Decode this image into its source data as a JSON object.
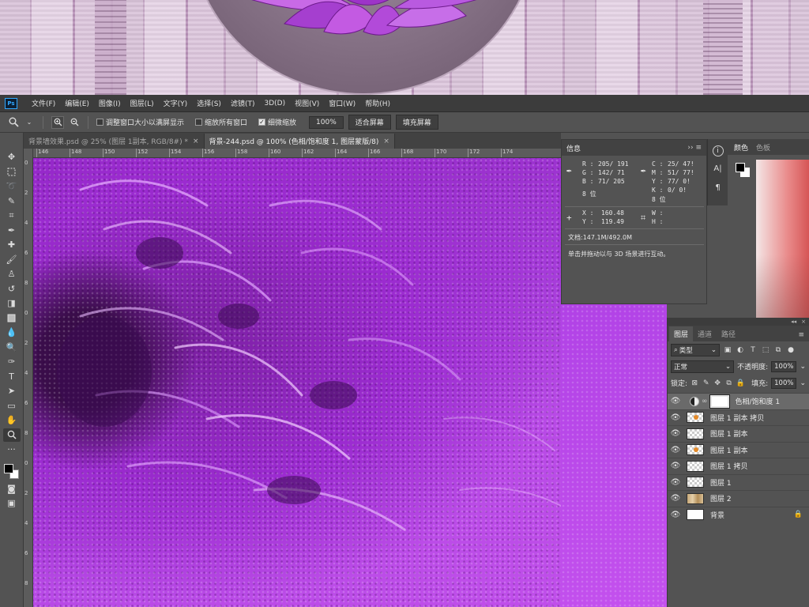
{
  "menu": [
    "文件(F)",
    "编辑(E)",
    "图像(I)",
    "图层(L)",
    "文字(Y)",
    "选择(S)",
    "滤镜(T)",
    "3D(D)",
    "视图(V)",
    "窗口(W)",
    "帮助(H)"
  ],
  "app_logo": "Ps",
  "options": {
    "resize_windows": "调整窗口大小以满屏显示",
    "zoom_all_windows": "缩放所有窗口",
    "scrubby_zoom": "细微缩放",
    "zoom_value": "100%",
    "fit_screen": "适合屏幕",
    "fill_screen": "填充屏幕"
  },
  "tabs": [
    {
      "label": "背景墙效果.psd @ 25% (图层 1副本, RGB/8#) *",
      "active": false
    },
    {
      "label": "背景-244.psd @ 100% (色相/饱和度 1, 图层蒙版/8)",
      "active": true
    }
  ],
  "ruler_h": [
    "146",
    "148",
    "150",
    "152",
    "154",
    "156",
    "158",
    "160",
    "162",
    "164",
    "166",
    "168",
    "170",
    "172",
    "174"
  ],
  "ruler_v": [
    "0",
    "2",
    "4",
    "6",
    "8",
    "0",
    "2",
    "4",
    "6",
    "8",
    "0",
    "2",
    "4",
    "6",
    "8"
  ],
  "info": {
    "title": "信息",
    "r": "R :",
    "r_val": "205/ 191",
    "g": "G :",
    "g_val": "142/ 71",
    "b": "B :",
    "b_val": "71/ 205",
    "bit1": "8 位",
    "c": "C :",
    "c_val": "25/ 47!",
    "m": "M :",
    "m_val": "51/ 77!",
    "y": "Y :",
    "y_val": "77/ 0!",
    "k": "K :",
    "k_val": "0/ 0!",
    "bit2": "8 位",
    "x": "X :",
    "x_val": "160.48",
    "yy": "Y :",
    "yy_val": "119.49",
    "w": "W :",
    "h": "H :",
    "doc": "文档:147.1M/492.0M",
    "hint": "单击并拖动以与 3D 场景进行互动。"
  },
  "colorpanel": {
    "tab_color": "颜色",
    "tab_swatches": "色板"
  },
  "layers": {
    "tab_layers": "图层",
    "tab_channels": "通道",
    "tab_paths": "路径",
    "filter_kind": "类型",
    "blend_mode": "正常",
    "opacity_label": "不透明度:",
    "opacity_value": "100%",
    "lock_label": "锁定:",
    "fill_label": "填充:",
    "fill_value": "100%",
    "items": [
      {
        "name": "色相/饱和度 1"
      },
      {
        "name": "图层 1 副本 拷贝"
      },
      {
        "name": "图层 1 副本"
      },
      {
        "name": "图层 1 副本"
      },
      {
        "name": "图层 1 拷贝"
      },
      {
        "name": "图层 1"
      },
      {
        "name": "图层 2"
      },
      {
        "name": "背景"
      }
    ]
  }
}
